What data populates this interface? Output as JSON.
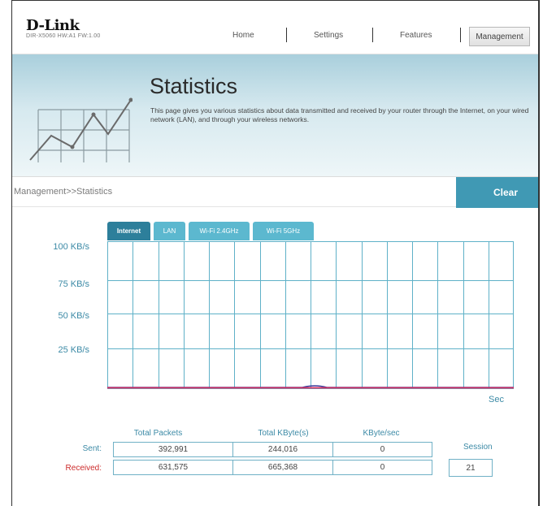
{
  "header": {
    "logo": "D-Link",
    "model_info": "DIR-X5060 HW:A1 FW:1.00",
    "nav": [
      "Home",
      "Settings",
      "Features",
      "Management"
    ],
    "active_nav": "Management"
  },
  "banner": {
    "title": "Statistics",
    "description": "This page gives you various statistics about data transmitted and received by your router through the Internet, on your wired network (LAN), and through your wireless networks.",
    "icon": "line-chart-icon"
  },
  "breadcrumb": "Management>>Statistics",
  "clear_button": "Clear",
  "tabs": [
    "Internet",
    "LAN",
    "Wi-Fi 2.4GHz",
    "Wi-Fi 5GHz"
  ],
  "active_tab": "Internet",
  "graph": {
    "y_labels": [
      "100 KB/s",
      "75 KB/s",
      "50 KB/s",
      "25 KB/s"
    ],
    "x_label": "Sec",
    "colors": {
      "grid": "#5fb1c8",
      "received": "#d83060",
      "sent": "#3a3a9a"
    }
  },
  "stats": {
    "columns": [
      "Total Packets",
      "Total KByte(s)",
      "KByte/sec"
    ],
    "rows": [
      {
        "label": "Sent:",
        "values": [
          "392,991",
          "244,016",
          "0"
        ]
      },
      {
        "label": "Received:",
        "values": [
          "631,575",
          "665,368",
          "0"
        ]
      }
    ],
    "session_label": "Session",
    "session_value": "21"
  },
  "colors": {
    "accent": "#4099b4",
    "tab_active": "#2d7f9b",
    "tab_inactive": "#5cb8cf",
    "received_label": "#cc2b2b"
  }
}
